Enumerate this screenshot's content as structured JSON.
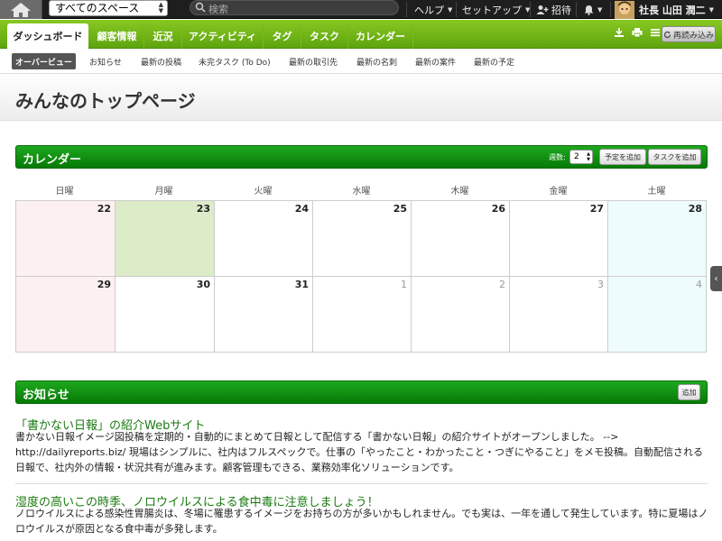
{
  "topbar": {
    "space_select": "すべてのスペース",
    "search_placeholder": "検索",
    "help": "ヘルプ",
    "setup": "セットアップ",
    "invite": "招待",
    "user_name": "社長 山田 潤二"
  },
  "tabs": [
    "ダッシュボード",
    "顧客情報",
    "近況",
    "アクティビティ",
    "タグ",
    "タスク",
    "カレンダー"
  ],
  "reload_label": "再読み込み",
  "subnav": [
    "オーバービュー",
    "お知らせ",
    "最新の投稿",
    "未完タスク (To Do)",
    "最新の取引先",
    "最新の名刺",
    "最新の案件",
    "最新の予定"
  ],
  "page_title": "みんなのトップページ",
  "calendar": {
    "title": "カレンダー",
    "weeks_label": "週数:",
    "weeks_value": "2",
    "add_event": "予定を追加",
    "add_task": "タスクを追加",
    "weekdays": [
      "日曜",
      "月曜",
      "火曜",
      "水曜",
      "木曜",
      "金曜",
      "土曜"
    ],
    "week1": [
      "22",
      "23",
      "24",
      "25",
      "26",
      "27",
      "28"
    ],
    "week2": [
      "29",
      "30",
      "31",
      "1",
      "2",
      "3",
      "4"
    ]
  },
  "news": {
    "title": "お知らせ",
    "add_label": "追加",
    "items": [
      {
        "title": "「書かない日報」の紹介Webサイト",
        "body": "書かない日報イメージ図投稿を定期的・自動的にまとめて日報として配信する「書かない日報」の紹介サイトがオープンしました。 --> http://dailyreports.biz/ 現場はシンプルに、社内はフルスペックで。仕事の「やったこと・わかったこと・つぎにやること」をメモ投稿。自動配信される日報で、社内外の情報・状況共有が進みます。顧客管理もできる、業務効率化ソリューションです。"
      },
      {
        "title": "湿度の高いこの時季、ノロウイルスによる食中毒に注意しましょう！",
        "body": "ノロウイルスによる感染性胃腸炎は、冬場に罹患するイメージをお持ちの方が多いかもしれません。でも実は、一年を通して発生しています。特に夏場はノロウイルスが原因となる食中毒が多発します。"
      }
    ]
  },
  "colors": {
    "green_bar": "#6db214",
    "section_green": "#0d8c0d",
    "sunday_bg": "#fdf0f0",
    "today_bg": "#dcebc8",
    "saturday_bg": "#eefcfd"
  }
}
